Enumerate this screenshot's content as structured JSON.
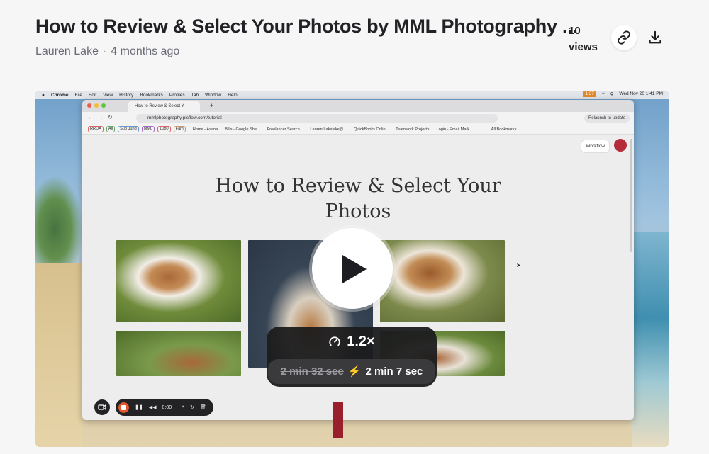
{
  "header": {
    "title": "How to Review & Select Your Photos by MML Photography ...",
    "author": "Lauren Lake",
    "separator": "·",
    "posted": "4 months ago",
    "views_count": "10",
    "views_label": "views"
  },
  "actions": {
    "link_icon": "link-icon",
    "download_icon": "download-icon"
  },
  "video": {
    "menubar": {
      "items": [
        "Chrome",
        "File",
        "Edit",
        "View",
        "History",
        "Bookmarks",
        "Profiles",
        "Tab",
        "Window",
        "Help"
      ],
      "datetime": "Wed Nov 20  1:41 PM",
      "battery": "1:37"
    },
    "browser": {
      "tab_title": "How to Review & Select Y",
      "new_tab": "+",
      "url": "mmlphotography.picflow.com/tutorial",
      "relaunch": "Relaunch to update",
      "bookmark_chips": [
        "RRDA",
        "All",
        "Sub Jung",
        "MML",
        "1080",
        "Fam"
      ],
      "bookmarks": [
        "Home - Asana",
        "Bills - Google She...",
        "Freelancer Search...",
        "Lauren Lakelake@...",
        "QuickBooks Onlin...",
        "Teamwork Projects",
        "Login - Email Mark..."
      ],
      "all_bookmarks": "All Bookmarks"
    },
    "page": {
      "title": "How to Review & Select Your Photos",
      "workflow_label": "Workflow"
    },
    "speed": {
      "rate": "1.2×",
      "original_duration": "2 min 32 sec",
      "bolt": "⚡",
      "new_duration": "2 min 7 sec"
    },
    "recorder": {
      "time": "0:00"
    }
  }
}
